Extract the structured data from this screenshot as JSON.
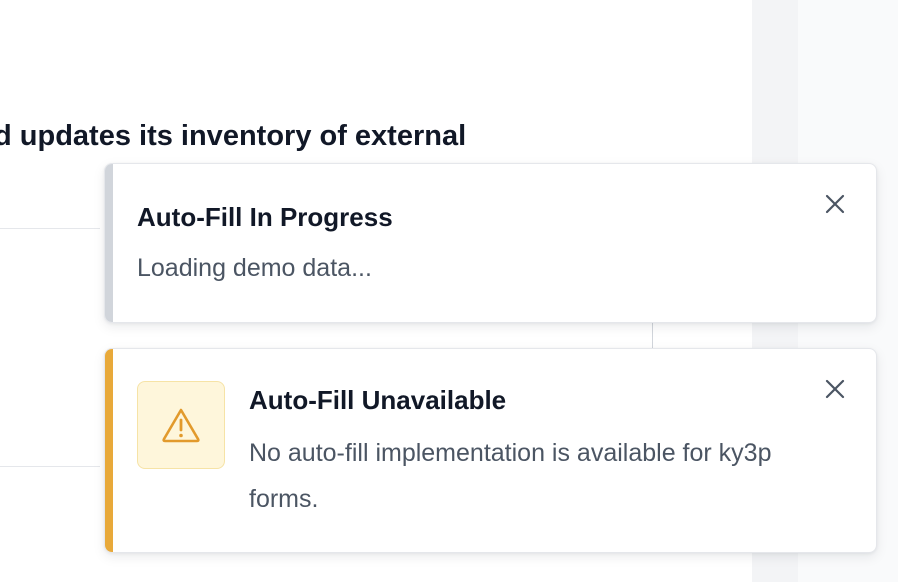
{
  "background": {
    "heading_fragment": "d updates its inventory of external"
  },
  "toasts": [
    {
      "title": "Auto-Fill In Progress",
      "description": "Loading demo data...",
      "accent_color": "#d1d5db",
      "close_icon": "close-icon"
    },
    {
      "title": "Auto-Fill Unavailable",
      "description": "No auto-fill implementation is available for ky3p forms.",
      "accent_color": "#e8a93a",
      "icon": "warning-triangle-icon",
      "close_icon": "close-icon"
    }
  ]
}
